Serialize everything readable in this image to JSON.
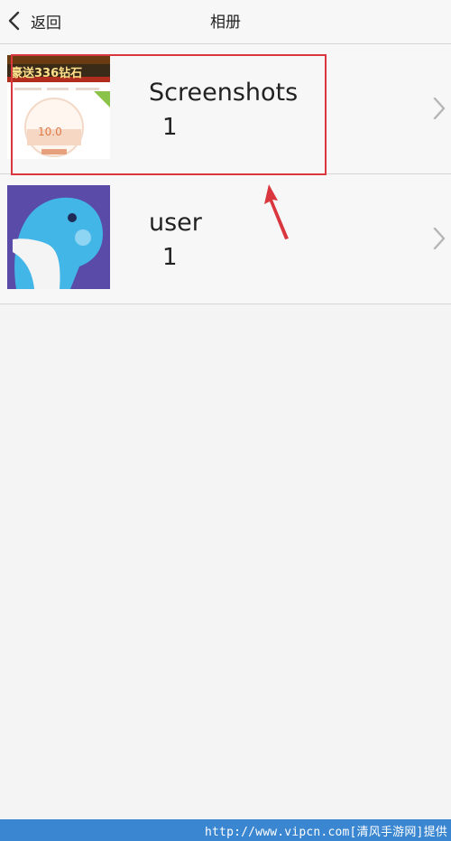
{
  "header": {
    "back_label": "返回",
    "title": "相册"
  },
  "albums": [
    {
      "name": "Screenshots",
      "count": "1",
      "thumbnail": {
        "banner_text": "豪送336钻石",
        "value_text": "10.0"
      }
    },
    {
      "name": "user",
      "count": "1"
    }
  ],
  "watermark": {
    "text": "http://www.vipcn.com[清风手游网]提供"
  },
  "colors": {
    "highlight": "#d9363e",
    "watermark_bar": "#3a86d0"
  }
}
